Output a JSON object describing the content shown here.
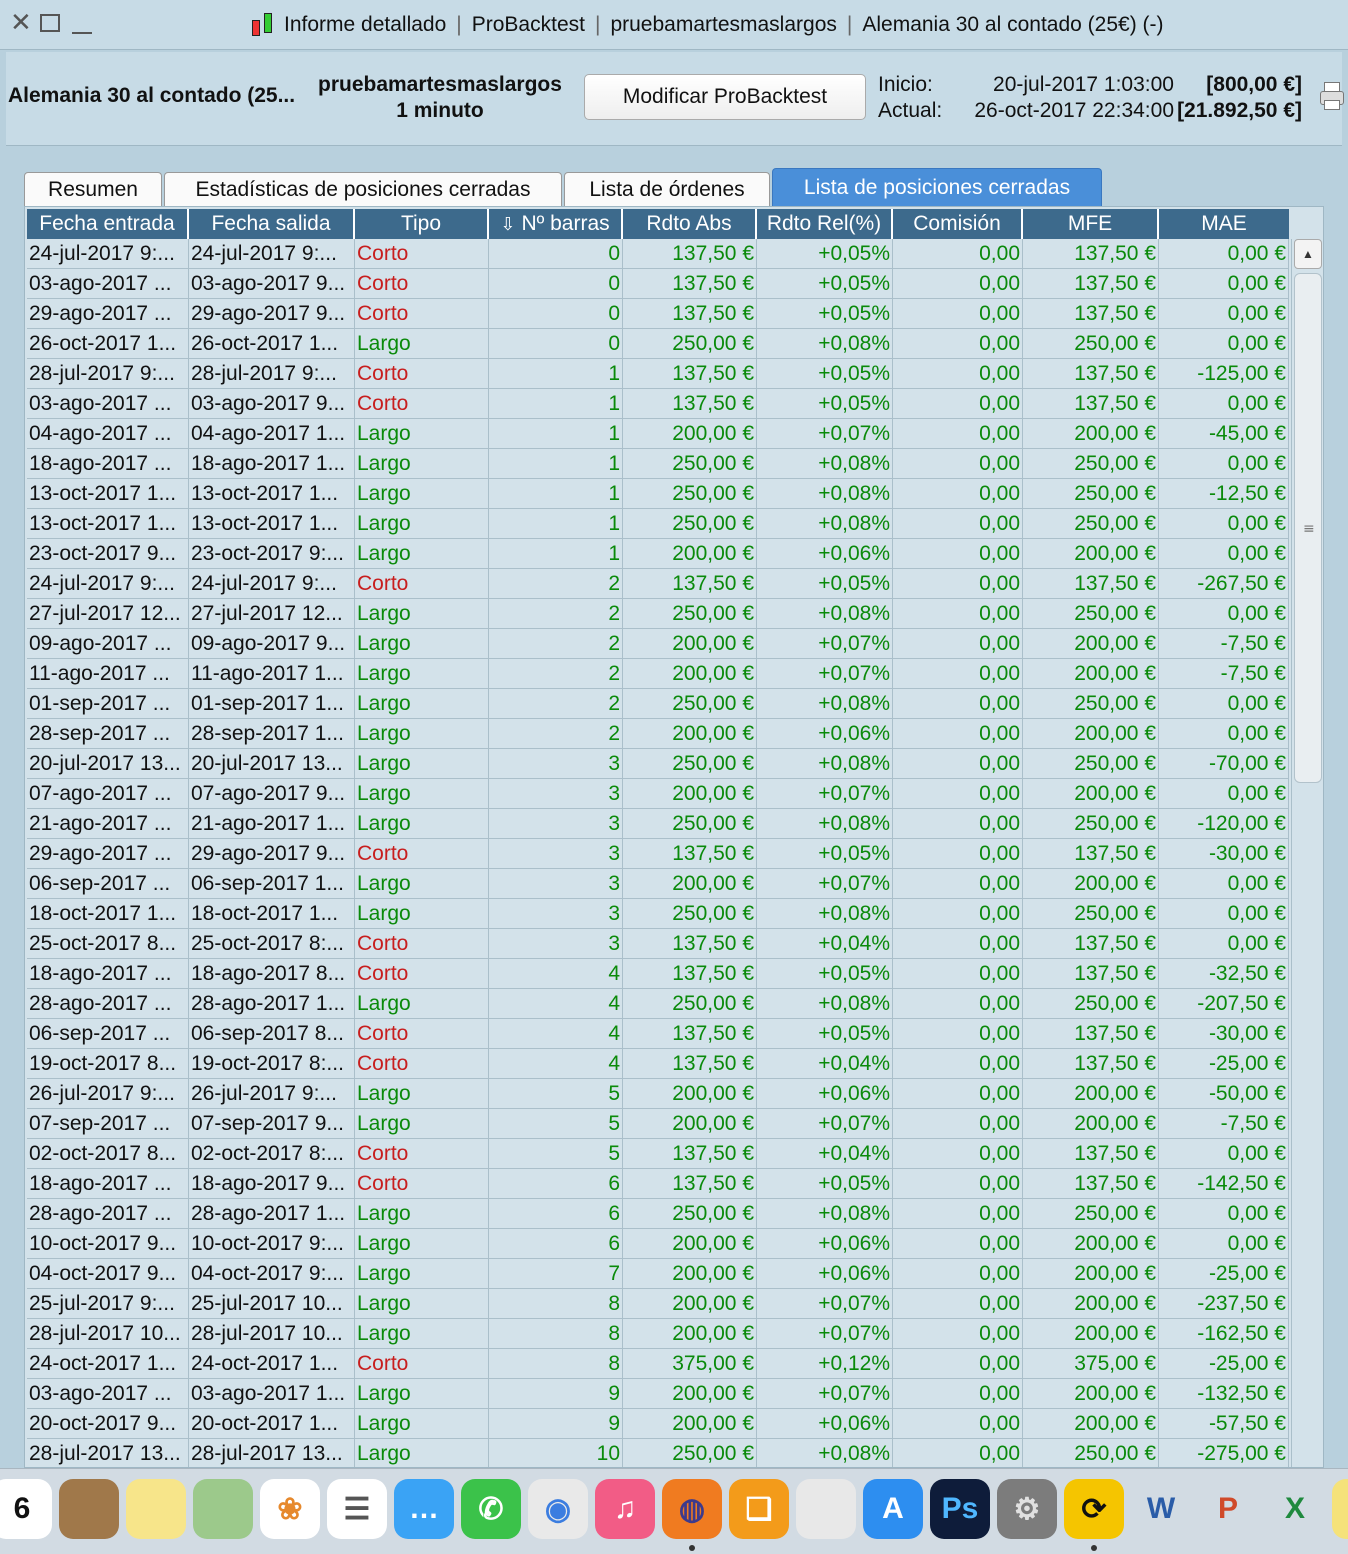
{
  "window": {
    "title_parts": [
      "Informe detallado",
      "ProBacktest",
      "pruebamartesmaslargos",
      "Alemania 30 al contado (25€) (-)"
    ],
    "close_icon": "close-icon",
    "maximize_icon": "maximize-icon",
    "minimize_icon": "minimize-icon",
    "app_icon": "candlestick-icon"
  },
  "header": {
    "instrument": "Alemania 30 al contado (25...",
    "system_name": "pruebamartesmaslargos",
    "timeframe": "1 minuto",
    "modify_button": "Modificar ProBacktest",
    "start_label": "Inicio:",
    "start_date": "20-jul-2017 1:03:00",
    "start_amount": "[800,00 €]",
    "current_label": "Actual:",
    "current_date": "26-oct-2017 22:34:00",
    "current_amount": "[21.892,50 €]"
  },
  "tabs": [
    {
      "label": "Resumen",
      "active": false
    },
    {
      "label": "Estadísticas de posiciones cerradas",
      "active": false
    },
    {
      "label": "Lista de órdenes",
      "active": false
    },
    {
      "label": "Lista de posiciones cerradas",
      "active": true
    }
  ],
  "table": {
    "columns": [
      "Fecha entrada",
      "Fecha salida",
      "Tipo",
      "Nº barras",
      "Rdto Abs",
      "Rdto Rel(%)",
      "Comisión",
      "MFE",
      "MAE"
    ],
    "sort_icon": "sort-down-icon",
    "rows": [
      [
        "24-jul-2017 9:...",
        "24-jul-2017 9:...",
        "Corto",
        "0",
        "137,50 €",
        "+0,05%",
        "0,00",
        "137,50 €",
        "0,00 €"
      ],
      [
        "03-ago-2017 ...",
        "03-ago-2017 9...",
        "Corto",
        "0",
        "137,50 €",
        "+0,05%",
        "0,00",
        "137,50 €",
        "0,00 €"
      ],
      [
        "29-ago-2017 ...",
        "29-ago-2017 9...",
        "Corto",
        "0",
        "137,50 €",
        "+0,05%",
        "0,00",
        "137,50 €",
        "0,00 €"
      ],
      [
        "26-oct-2017 1...",
        "26-oct-2017 1...",
        "Largo",
        "0",
        "250,00 €",
        "+0,08%",
        "0,00",
        "250,00 €",
        "0,00 €"
      ],
      [
        "28-jul-2017 9:...",
        "28-jul-2017 9:...",
        "Corto",
        "1",
        "137,50 €",
        "+0,05%",
        "0,00",
        "137,50 €",
        "-125,00 €"
      ],
      [
        "03-ago-2017 ...",
        "03-ago-2017 9...",
        "Corto",
        "1",
        "137,50 €",
        "+0,05%",
        "0,00",
        "137,50 €",
        "0,00 €"
      ],
      [
        "04-ago-2017 ...",
        "04-ago-2017 1...",
        "Largo",
        "1",
        "200,00 €",
        "+0,07%",
        "0,00",
        "200,00 €",
        "-45,00 €"
      ],
      [
        "18-ago-2017 ...",
        "18-ago-2017 1...",
        "Largo",
        "1",
        "250,00 €",
        "+0,08%",
        "0,00",
        "250,00 €",
        "0,00 €"
      ],
      [
        "13-oct-2017 1...",
        "13-oct-2017 1...",
        "Largo",
        "1",
        "250,00 €",
        "+0,08%",
        "0,00",
        "250,00 €",
        "-12,50 €"
      ],
      [
        "13-oct-2017 1...",
        "13-oct-2017 1...",
        "Largo",
        "1",
        "250,00 €",
        "+0,08%",
        "0,00",
        "250,00 €",
        "0,00 €"
      ],
      [
        "23-oct-2017 9...",
        "23-oct-2017 9:...",
        "Largo",
        "1",
        "200,00 €",
        "+0,06%",
        "0,00",
        "200,00 €",
        "0,00 €"
      ],
      [
        "24-jul-2017 9:...",
        "24-jul-2017 9:...",
        "Corto",
        "2",
        "137,50 €",
        "+0,05%",
        "0,00",
        "137,50 €",
        "-267,50 €"
      ],
      [
        "27-jul-2017 12...",
        "27-jul-2017 12...",
        "Largo",
        "2",
        "250,00 €",
        "+0,08%",
        "0,00",
        "250,00 €",
        "0,00 €"
      ],
      [
        "09-ago-2017 ...",
        "09-ago-2017 9...",
        "Largo",
        "2",
        "200,00 €",
        "+0,07%",
        "0,00",
        "200,00 €",
        "-7,50 €"
      ],
      [
        "11-ago-2017 ...",
        "11-ago-2017 1...",
        "Largo",
        "2",
        "200,00 €",
        "+0,07%",
        "0,00",
        "200,00 €",
        "-7,50 €"
      ],
      [
        "01-sep-2017 ...",
        "01-sep-2017 1...",
        "Largo",
        "2",
        "250,00 €",
        "+0,08%",
        "0,00",
        "250,00 €",
        "0,00 €"
      ],
      [
        "28-sep-2017 ...",
        "28-sep-2017 1...",
        "Largo",
        "2",
        "200,00 €",
        "+0,06%",
        "0,00",
        "200,00 €",
        "0,00 €"
      ],
      [
        "20-jul-2017 13...",
        "20-jul-2017 13...",
        "Largo",
        "3",
        "250,00 €",
        "+0,08%",
        "0,00",
        "250,00 €",
        "-70,00 €"
      ],
      [
        "07-ago-2017 ...",
        "07-ago-2017 9...",
        "Largo",
        "3",
        "200,00 €",
        "+0,07%",
        "0,00",
        "200,00 €",
        "0,00 €"
      ],
      [
        "21-ago-2017 ...",
        "21-ago-2017 1...",
        "Largo",
        "3",
        "250,00 €",
        "+0,08%",
        "0,00",
        "250,00 €",
        "-120,00 €"
      ],
      [
        "29-ago-2017 ...",
        "29-ago-2017 9...",
        "Corto",
        "3",
        "137,50 €",
        "+0,05%",
        "0,00",
        "137,50 €",
        "-30,00 €"
      ],
      [
        "06-sep-2017 ...",
        "06-sep-2017 1...",
        "Largo",
        "3",
        "200,00 €",
        "+0,07%",
        "0,00",
        "200,00 €",
        "0,00 €"
      ],
      [
        "18-oct-2017 1...",
        "18-oct-2017 1...",
        "Largo",
        "3",
        "250,00 €",
        "+0,08%",
        "0,00",
        "250,00 €",
        "0,00 €"
      ],
      [
        "25-oct-2017 8...",
        "25-oct-2017 8:...",
        "Corto",
        "3",
        "137,50 €",
        "+0,04%",
        "0,00",
        "137,50 €",
        "0,00 €"
      ],
      [
        "18-ago-2017 ...",
        "18-ago-2017 8...",
        "Corto",
        "4",
        "137,50 €",
        "+0,05%",
        "0,00",
        "137,50 €",
        "-32,50 €"
      ],
      [
        "28-ago-2017 ...",
        "28-ago-2017 1...",
        "Largo",
        "4",
        "250,00 €",
        "+0,08%",
        "0,00",
        "250,00 €",
        "-207,50 €"
      ],
      [
        "06-sep-2017 ...",
        "06-sep-2017 8...",
        "Corto",
        "4",
        "137,50 €",
        "+0,05%",
        "0,00",
        "137,50 €",
        "-30,00 €"
      ],
      [
        "19-oct-2017 8...",
        "19-oct-2017 8:...",
        "Corto",
        "4",
        "137,50 €",
        "+0,04%",
        "0,00",
        "137,50 €",
        "-25,00 €"
      ],
      [
        "26-jul-2017 9:...",
        "26-jul-2017 9:...",
        "Largo",
        "5",
        "200,00 €",
        "+0,06%",
        "0,00",
        "200,00 €",
        "-50,00 €"
      ],
      [
        "07-sep-2017 ...",
        "07-sep-2017 9...",
        "Largo",
        "5",
        "200,00 €",
        "+0,07%",
        "0,00",
        "200,00 €",
        "-7,50 €"
      ],
      [
        "02-oct-2017 8...",
        "02-oct-2017 8:...",
        "Corto",
        "5",
        "137,50 €",
        "+0,04%",
        "0,00",
        "137,50 €",
        "0,00 €"
      ],
      [
        "18-ago-2017 ...",
        "18-ago-2017 9...",
        "Corto",
        "6",
        "137,50 €",
        "+0,05%",
        "0,00",
        "137,50 €",
        "-142,50 €"
      ],
      [
        "28-ago-2017 ...",
        "28-ago-2017 1...",
        "Largo",
        "6",
        "250,00 €",
        "+0,08%",
        "0,00",
        "250,00 €",
        "0,00 €"
      ],
      [
        "10-oct-2017 9...",
        "10-oct-2017 9:...",
        "Largo",
        "6",
        "200,00 €",
        "+0,06%",
        "0,00",
        "200,00 €",
        "0,00 €"
      ],
      [
        "04-oct-2017 9...",
        "04-oct-2017 9:...",
        "Largo",
        "7",
        "200,00 €",
        "+0,06%",
        "0,00",
        "200,00 €",
        "-25,00 €"
      ],
      [
        "25-jul-2017 9:...",
        "25-jul-2017 10...",
        "Largo",
        "8",
        "200,00 €",
        "+0,07%",
        "0,00",
        "200,00 €",
        "-237,50 €"
      ],
      [
        "28-jul-2017 10...",
        "28-jul-2017 10...",
        "Largo",
        "8",
        "200,00 €",
        "+0,07%",
        "0,00",
        "200,00 €",
        "-162,50 €"
      ],
      [
        "24-oct-2017 1...",
        "24-oct-2017 1...",
        "Corto",
        "8",
        "375,00 €",
        "+0,12%",
        "0,00",
        "375,00 €",
        "-25,00 €"
      ],
      [
        "03-ago-2017 ...",
        "03-ago-2017 1...",
        "Largo",
        "9",
        "200,00 €",
        "+0,07%",
        "0,00",
        "200,00 €",
        "-132,50 €"
      ],
      [
        "20-oct-2017 9...",
        "20-oct-2017 1...",
        "Largo",
        "9",
        "200,00 €",
        "+0,06%",
        "0,00",
        "200,00 €",
        "-57,50 €"
      ],
      [
        "28-jul-2017 13...",
        "28-jul-2017 13...",
        "Largo",
        "10",
        "250,00 €",
        "+0,08%",
        "0,00",
        "250,00 €",
        "-275,00 €"
      ]
    ]
  },
  "colors": {
    "positive": "#0a8a0a",
    "corto": "#c81e1e",
    "header_bg": "#3d6a8c",
    "active_tab": "#4a8fd9"
  },
  "dock": {
    "icons": [
      {
        "name": "calendar-icon",
        "glyph": "6",
        "bg": "#ffffff",
        "fg": "#111111"
      },
      {
        "name": "contacts-icon",
        "glyph": "",
        "bg": "#a0784a",
        "fg": "#ffffff"
      },
      {
        "name": "notes-icon",
        "glyph": "",
        "bg": "#f7e58a",
        "fg": "#333333"
      },
      {
        "name": "maps-icon",
        "glyph": "",
        "bg": "#9cc98b",
        "fg": "#ffffff"
      },
      {
        "name": "photos-icon",
        "glyph": "❀",
        "bg": "#ffffff",
        "fg": "#e6892d"
      },
      {
        "name": "reminders-icon",
        "glyph": "☰",
        "bg": "#ffffff",
        "fg": "#555555"
      },
      {
        "name": "messages-icon",
        "glyph": "…",
        "bg": "#3aa3f5",
        "fg": "#ffffff"
      },
      {
        "name": "facetime-icon",
        "glyph": "✆",
        "bg": "#3bc24a",
        "fg": "#ffffff"
      },
      {
        "name": "chrome-icon",
        "glyph": "◉",
        "bg": "#e9e9e9",
        "fg": "#3b7de0"
      },
      {
        "name": "itunes-icon",
        "glyph": "♫",
        "bg": "#f25c86",
        "fg": "#ffffff"
      },
      {
        "name": "firefox-icon",
        "glyph": "◍",
        "bg": "#f07b20",
        "fg": "#3d3a8c"
      },
      {
        "name": "ibooks-icon",
        "glyph": "❑",
        "bg": "#f39b1a",
        "fg": "#ffffff"
      },
      {
        "name": "prorealtime-icon",
        "glyph": "",
        "bg": "#e8e8e8",
        "fg": "#222222"
      },
      {
        "name": "appstore-icon",
        "glyph": "A",
        "bg": "#2d8ef0",
        "fg": "#ffffff"
      },
      {
        "name": "photoshop-icon",
        "glyph": "Ps",
        "bg": "#0e1c3a",
        "fg": "#4fb7ff"
      },
      {
        "name": "system-preferences-icon",
        "glyph": "⚙",
        "bg": "#7c7c7c",
        "fg": "#e0e0e0"
      },
      {
        "name": "sync-icon",
        "glyph": "⟳",
        "bg": "#f5c500",
        "fg": "#111111"
      },
      {
        "name": "word-icon",
        "glyph": "W",
        "bg": "#d2dbe3",
        "fg": "#2a5ca8"
      },
      {
        "name": "powerpoint-icon",
        "glyph": "P",
        "bg": "#d2dbe3",
        "fg": "#d04a2a"
      },
      {
        "name": "excel-icon",
        "glyph": "X",
        "bg": "#d2dbe3",
        "fg": "#1f8a3e"
      },
      {
        "name": "chart-app-icon",
        "glyph": "",
        "bg": "#f5e27a",
        "fg": "#c33"
      }
    ]
  }
}
